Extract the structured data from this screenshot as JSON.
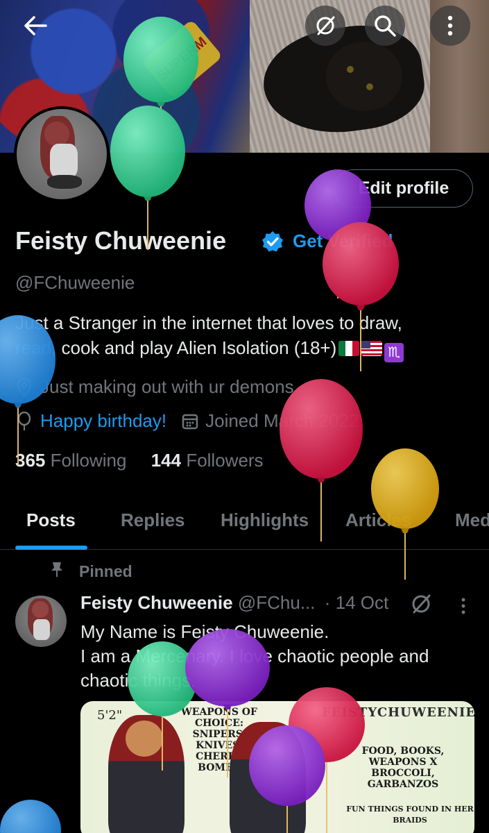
{
  "header": {
    "back_icon": "arrow-left-icon",
    "actions": [
      "grok-icon",
      "search-icon",
      "more-vertical-icon"
    ]
  },
  "banner": {
    "text": "SUPERM"
  },
  "profile": {
    "edit_label": "Edit profile",
    "name": "Feisty Chuweenie",
    "get_verified": "Get Verified",
    "handle": "@FChuweenie",
    "bio_start": "Just a Stranger in the internet that loves to draw,",
    "bio_link": "read",
    "bio_rest": ", cook and play Alien Isolation (18+)",
    "location": "Just making out with ur demons",
    "birthday": "Happy birthday!",
    "joined": "Joined March 2022",
    "following_count": "365",
    "following_label": "Following",
    "followers_count": "144",
    "followers_label": "Followers"
  },
  "tabs": [
    {
      "label": "Posts",
      "active": true
    },
    {
      "label": "Replies",
      "active": false
    },
    {
      "label": "Highlights",
      "active": false
    },
    {
      "label": "Articles",
      "active": false
    },
    {
      "label": "Media",
      "active": false
    }
  ],
  "post": {
    "pinned_label": "Pinned",
    "author": "Feisty Chuweenie",
    "handle": "@FChu...",
    "date": "· 14 Oct",
    "line1": "My  Name is Feisty Chuweenie.",
    "line2": "I am a Mercenary. I love chaotic people and",
    "line3": "chaotic things.",
    "image": {
      "height_label": "5'2\"",
      "title": "FEISTYCHUWEENIE",
      "weapons": "WEAPONS OF CHOICE: SNIPERS, KNIVES, CHERRY BOMBS",
      "likes": "FOOD, BOOKS, WEAPONS X BROCCOLI, GARBANZOS",
      "braids": "FUN THINGS FOUND IN HER BRAIDS"
    }
  },
  "colors": {
    "accent": "#1d9bf0",
    "muted": "#71767b",
    "text": "#e7e9ea",
    "balloon_green": "#3ed69b",
    "balloon_purple": "#8e2fd0",
    "balloon_red": "#e02653",
    "balloon_yellow": "#e4b21f",
    "balloon_blue": "#2b8ee0"
  }
}
